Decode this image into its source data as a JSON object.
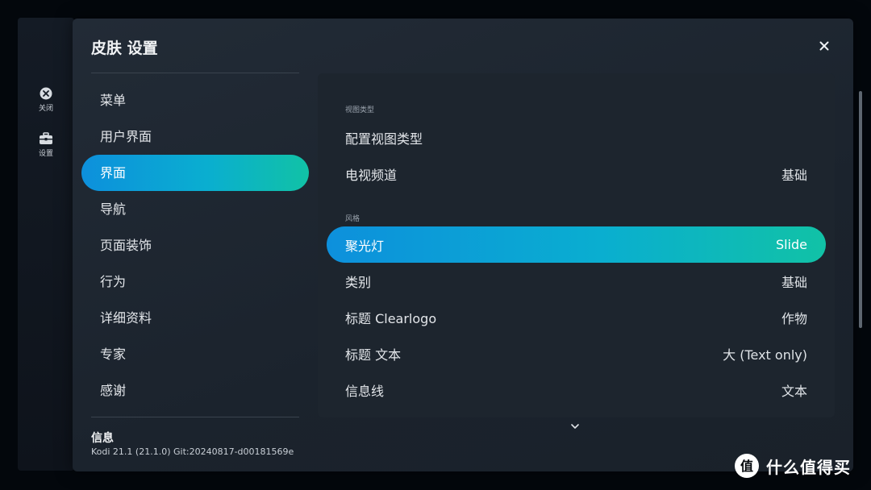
{
  "rail": {
    "items": [
      {
        "label": "关闭",
        "icon": "close-circle-icon"
      },
      {
        "label": "设置",
        "icon": "toolbox-icon"
      }
    ]
  },
  "dialog": {
    "title": "皮肤 设置",
    "close_icon": "close-icon"
  },
  "categories": [
    {
      "label": "菜单",
      "active": false
    },
    {
      "label": "用户界面",
      "active": false
    },
    {
      "label": "界面",
      "active": true
    },
    {
      "label": "导航",
      "active": false
    },
    {
      "label": "页面装饰",
      "active": false
    },
    {
      "label": "行为",
      "active": false
    },
    {
      "label": "详细资料",
      "active": false
    },
    {
      "label": "专家",
      "active": false
    },
    {
      "label": "感谢",
      "active": false
    }
  ],
  "info": {
    "title": "信息",
    "text": "Kodi 21.1 (21.1.0) Git:20240817-d00181569e"
  },
  "settings": {
    "section_view_type": "视图类型",
    "section_style": "风格",
    "rows": [
      {
        "label": "配置视图类型",
        "value": ""
      },
      {
        "label": "电视频道",
        "value": "基础"
      },
      {
        "label": "聚光灯",
        "value": "Slide",
        "active": true
      },
      {
        "label": "类别",
        "value": "基础"
      },
      {
        "label": "标题 Clearlogo",
        "value": "作物"
      },
      {
        "label": "标题 文本",
        "value": "大 (Text only)"
      },
      {
        "label": "信息线",
        "value": "文本"
      }
    ]
  },
  "watermark": {
    "text": "什么值得买",
    "icon": "smzdm-logo-icon"
  },
  "colors": {
    "accent_start": "#0d90dc",
    "accent_end": "#11c2a6",
    "dialog_bg": "#222b36",
    "panel_bg": "#1d252e"
  }
}
